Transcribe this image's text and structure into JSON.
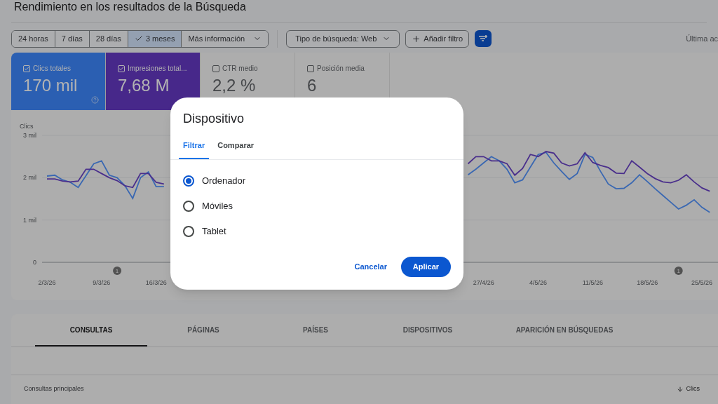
{
  "page_title": "Rendimiento en los resultados de la Búsqueda",
  "date_ranges": [
    {
      "label": "24 horas",
      "selected": false
    },
    {
      "label": "7 días",
      "selected": false
    },
    {
      "label": "28 días",
      "selected": false
    },
    {
      "label": "3 meses",
      "selected": true
    },
    {
      "label": "Más información",
      "selected": false,
      "kind": "dropdown"
    }
  ],
  "search_type": "Tipo de búsqueda: Web",
  "add_filter": "Añadir filtro",
  "last_update": "Última ac",
  "metrics": [
    {
      "label": "Clics totales",
      "value": "170 mil",
      "checked": true,
      "color": "#2b5fb2",
      "help": true
    },
    {
      "label": "Impresiones total...",
      "value": "7,68 M",
      "checked": true,
      "color": "#47288a",
      "help": false
    },
    {
      "label": "CTR medio",
      "value": "2,2 %",
      "checked": false,
      "help": false
    },
    {
      "label": "Posición media",
      "value": "6",
      "checked": false,
      "help": false
    }
  ],
  "chart": {
    "chart_data": {
      "type": "line",
      "ylabel": "Clics",
      "ylim": [
        0,
        3
      ],
      "yticks": [
        {
          "value": 0,
          "label": "0"
        },
        {
          "value": 1,
          "label": "1 mil"
        },
        {
          "value": 2,
          "label": "2 mil"
        },
        {
          "value": 3,
          "label": "3 mil"
        }
      ],
      "categories": [
        "2/3/26",
        null,
        null,
        null,
        null,
        null,
        null,
        "9/3/26",
        null,
        null,
        null,
        null,
        null,
        null,
        "16/3/26",
        null,
        null,
        null,
        null,
        null,
        null,
        null,
        null,
        null,
        null,
        null,
        null,
        null,
        null,
        null,
        null,
        null,
        null,
        null,
        null,
        null,
        null,
        null,
        null,
        null,
        null,
        null,
        null,
        null,
        null,
        null,
        null,
        null,
        null,
        null,
        null,
        null,
        null,
        null,
        null,
        null,
        "27/4/26",
        null,
        null,
        null,
        null,
        null,
        null,
        "4/5/26",
        null,
        null,
        null,
        null,
        null,
        null,
        "11/5/26",
        null,
        null,
        null,
        null,
        null,
        null,
        "18/5/26",
        null,
        null,
        null,
        null,
        null,
        null,
        "25/5/26",
        null
      ],
      "series": [
        {
          "color": "#3a68b2",
          "values": [
            2.04,
            2.06,
            1.95,
            1.89,
            1.77,
            2.05,
            2.33,
            2.4,
            2.06,
            2.0,
            1.81,
            1.51,
            2.0,
            2.14,
            1.79,
            1.79,
            null,
            null,
            null,
            null,
            null,
            null,
            null,
            null,
            null,
            null,
            null,
            null,
            null,
            null,
            null,
            null,
            null,
            null,
            null,
            null,
            null,
            null,
            null,
            null,
            null,
            null,
            null,
            null,
            null,
            null,
            null,
            null,
            null,
            null,
            null,
            null,
            null,
            null,
            2.07,
            2.2,
            2.35,
            2.5,
            2.4,
            2.2,
            1.88,
            1.95,
            2.25,
            2.55,
            2.6,
            2.35,
            2.15,
            1.96,
            2.1,
            2.55,
            2.48,
            2.15,
            1.85,
            1.74,
            1.75,
            1.88,
            2.07,
            1.91,
            1.74,
            1.58,
            1.42,
            1.26,
            1.35,
            1.48,
            1.3,
            1.18
          ]
        },
        {
          "color": "#4a2f8c",
          "values": [
            1.97,
            1.97,
            1.92,
            1.9,
            1.92,
            2.2,
            2.2,
            2.1,
            2.0,
            1.93,
            1.81,
            1.77,
            2.1,
            2.1,
            1.89,
            1.85,
            null,
            null,
            null,
            null,
            null,
            null,
            null,
            null,
            null,
            null,
            null,
            null,
            null,
            null,
            null,
            null,
            null,
            null,
            null,
            null,
            null,
            null,
            null,
            null,
            null,
            null,
            null,
            null,
            null,
            null,
            null,
            null,
            null,
            null,
            null,
            null,
            null,
            null,
            2.33,
            2.5,
            2.5,
            2.4,
            2.4,
            2.33,
            2.06,
            2.22,
            2.55,
            2.5,
            2.62,
            2.58,
            2.35,
            2.28,
            2.33,
            2.59,
            2.36,
            2.29,
            2.24,
            2.11,
            2.1,
            2.4,
            2.25,
            2.1,
            1.98,
            1.9,
            1.88,
            1.94,
            2.07,
            1.9,
            1.76,
            1.68
          ]
        }
      ],
      "annotations": [
        "1",
        "1"
      ]
    }
  },
  "tables_tabs": [
    {
      "label": "CONSULTAS",
      "selected": true
    },
    {
      "label": "PÁGINAS",
      "selected": false
    },
    {
      "label": "PAÍSES",
      "selected": false
    },
    {
      "label": "DISPOSITIVOS",
      "selected": false
    },
    {
      "label": "APARICIÓN EN BÚSQUEDAS",
      "selected": false
    }
  ],
  "table": {
    "column_1": "Consultas principales",
    "sort_column": "Clics"
  },
  "dialog": {
    "title": "Dispositivo",
    "tabs": [
      {
        "label": "Filtrar",
        "selected": true
      },
      {
        "label": "Comparar",
        "selected": false
      }
    ],
    "options": [
      {
        "label": "Ordenador",
        "selected": true
      },
      {
        "label": "Móviles",
        "selected": false
      },
      {
        "label": "Tablet",
        "selected": false
      }
    ],
    "cancel": "Cancelar",
    "apply": "Aplicar"
  }
}
